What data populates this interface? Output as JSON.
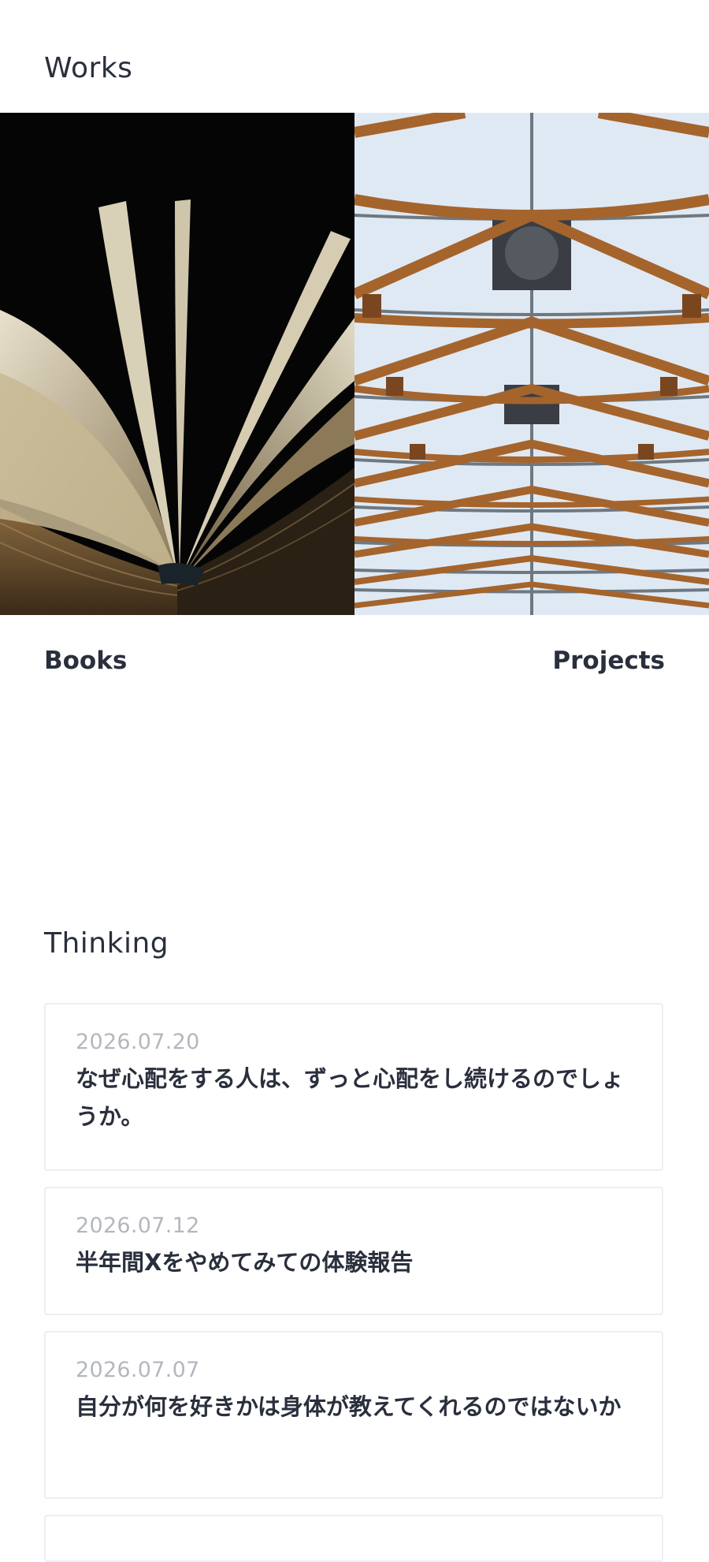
{
  "works": {
    "title": "Works",
    "items": [
      {
        "label": "Books"
      },
      {
        "label": "Projects"
      }
    ]
  },
  "thinking": {
    "title": "Thinking",
    "posts": [
      {
        "date": "2026.07.20",
        "title": "なぜ心配をする人は、ずっと心配をし続けるのでしょうか。"
      },
      {
        "date": "2026.07.12",
        "title": "半年間Xをやめてみての体験報告"
      },
      {
        "date": "2026.07.07",
        "title": "自分が何を好きかは身体が教えてくれるのではないか"
      }
    ]
  },
  "colors": {
    "text": "#2a2f3d",
    "date": "#b4b7bd",
    "card_border": "#eceef2"
  }
}
